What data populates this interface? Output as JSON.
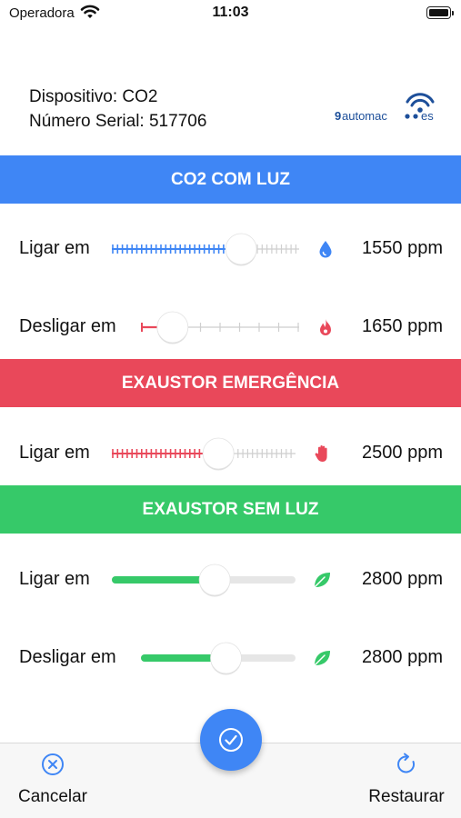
{
  "status_bar": {
    "carrier": "Operadora",
    "time": "11:03"
  },
  "device": {
    "name_line": "Dispositivo: CO2",
    "serial_line": "Número Serial: 517706",
    "logo_text": "9automacoes"
  },
  "sections": {
    "co2": {
      "title": "CO2 COM LUZ",
      "color": "#3f86f5",
      "on": {
        "label": "Ligar em",
        "value": "1550 ppm",
        "level": 0.69,
        "icon": "water-drop-icon"
      },
      "off": {
        "label": "Desligar em",
        "value": "1650 ppm",
        "level": 0.2,
        "icon": "flame-icon"
      }
    },
    "emergency": {
      "title": "EXAUSTOR EMERGÊNCIA",
      "color": "#e9485a",
      "on": {
        "label": "Ligar em",
        "value": "2500 ppm",
        "level": 0.58,
        "icon": "hand-stop-icon"
      }
    },
    "no_light": {
      "title": "EXAUSTOR SEM LUZ",
      "color": "#36c969",
      "on": {
        "label": "Ligar em",
        "value": "2800 ppm",
        "level": 0.56,
        "icon": "leaf-icon"
      },
      "off": {
        "label": "Desligar em",
        "value": "2800 ppm",
        "level": 0.55,
        "icon": "leaf-icon"
      }
    }
  },
  "footer": {
    "cancel_label": "Cancelar",
    "restore_label": "Restaurar"
  },
  "icons": {
    "cancel": "cancel-circle-icon",
    "restore": "refresh-icon",
    "confirm": "check-circle-icon"
  }
}
